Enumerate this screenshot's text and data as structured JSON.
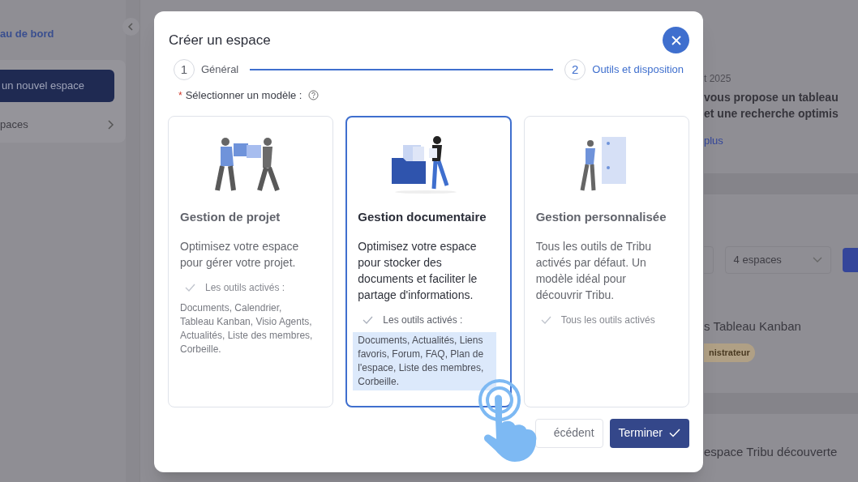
{
  "sidebar": {
    "link": "au de bord",
    "new_space_button": "un nouvel espace",
    "items": [
      {
        "label": "paces"
      }
    ]
  },
  "background": {
    "date": "t 2025",
    "headline": [
      "vous propose un tableau",
      "et une recherche optimis"
    ],
    "more_link": "plus",
    "filter": "4 espaces",
    "space_title": "s Tableau Kanban",
    "role_badge": "nistrateur",
    "space_title_2": "espace Tribu découverte"
  },
  "dialog": {
    "title": "Créer un espace",
    "steps": [
      {
        "number": "1",
        "label": "Général",
        "active": false
      },
      {
        "number": "2",
        "label": "Outils et disposition",
        "active": true
      }
    ],
    "field_label": "Sélectionner un modèle :",
    "required_mark": "*",
    "cards": [
      {
        "kind": "puzzle",
        "title": "Gestion de projet",
        "description": "Optimisez votre espace pour gérer votre projet.",
        "tools_label": "Les outils activés :",
        "tools": "Documents, Calendrier, Tableau Kanban, Visio Agents, Actualités, Liste des membres, Corbeille.",
        "selected": false
      },
      {
        "kind": "folder",
        "title": "Gestion documentaire",
        "description": "Optimisez votre espace pour stocker des documents et faciliter le partage d'informations.",
        "tools_label": "Les outils activés :",
        "tools": "Documents, Actualités, Liens favoris, Forum, FAQ, Plan de l'espace, Liste des membres, Corbeille.",
        "selected": true
      },
      {
        "kind": "board",
        "title": "Gestion personnalisée",
        "description": "Tous les outils de Tribu activés par défaut. Un modèle idéal pour découvrir Tribu.",
        "tools_label": "Tous les outils activés",
        "selected": false
      }
    ],
    "buttons": {
      "previous": "écédent",
      "finish": "Terminer"
    }
  }
}
